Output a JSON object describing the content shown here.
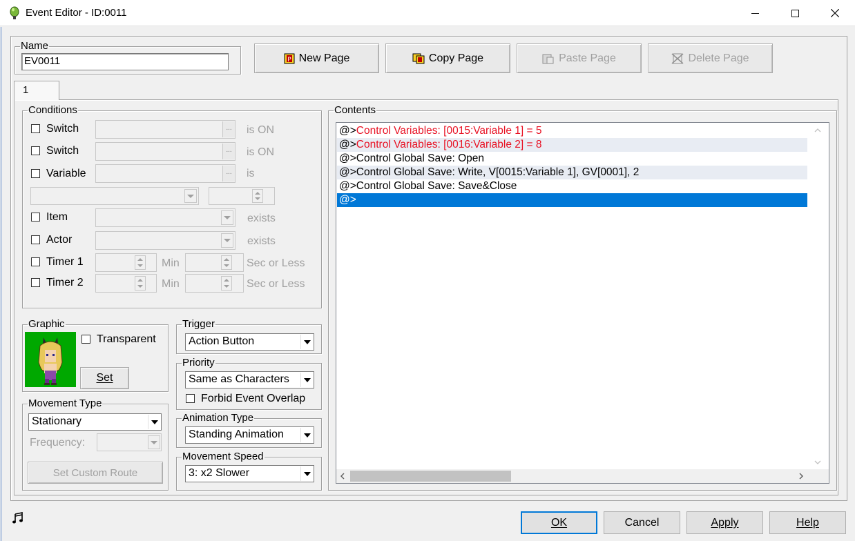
{
  "window": {
    "title": "Event Editor - ID:0011",
    "minimize_icon": "minimize-icon",
    "maximize_icon": "maximize-icon",
    "close_icon": "close-icon"
  },
  "name_group": {
    "legend": "Name",
    "value": "EV0011"
  },
  "page_buttons": {
    "new_page": "New Page",
    "copy_page": "Copy Page",
    "paste_page": "Paste Page",
    "delete_page": "Delete Page"
  },
  "tabs": [
    {
      "label": "1"
    }
  ],
  "conditions": {
    "legend": "Conditions",
    "switch1": {
      "label": "Switch",
      "suffix": "is ON"
    },
    "switch2": {
      "label": "Switch",
      "suffix": "is ON"
    },
    "variable": {
      "label": "Variable",
      "suffix": "is"
    },
    "item": {
      "label": "Item",
      "suffix": "exists"
    },
    "actor": {
      "label": "Actor",
      "suffix": "exists"
    },
    "timer1": {
      "label": "Timer 1",
      "min": "Min",
      "sec": "Sec or Less"
    },
    "timer2": {
      "label": "Timer 2",
      "min": "Min",
      "sec": "Sec or Less"
    },
    "ellipsis": "..."
  },
  "graphic": {
    "legend": "Graphic",
    "transparent_label": "Transparent",
    "set_label": "Set"
  },
  "movement_type": {
    "legend": "Movement Type",
    "value": "Stationary",
    "frequency_label": "Frequency:",
    "custom_route_label": "Set Custom Route"
  },
  "trigger": {
    "legend": "Trigger",
    "value": "Action Button"
  },
  "priority": {
    "legend": "Priority",
    "value": "Same as Characters",
    "forbid_label": "Forbid Event Overlap"
  },
  "animation_type": {
    "legend": "Animation Type",
    "value": "Standing Animation"
  },
  "movement_speed": {
    "legend": "Movement Speed",
    "value": "3: x2 Slower"
  },
  "contents": {
    "legend": "Contents",
    "rows": [
      {
        "prefix": "@>",
        "text": "Control Variables: [0015:Variable 1] = 5",
        "color": "#e81123"
      },
      {
        "prefix": "@>",
        "text": "Control Variables: [0016:Variable 2] = 8",
        "color": "#e81123"
      },
      {
        "prefix": "@>",
        "text": "Control Global Save: Open",
        "color": "#000000"
      },
      {
        "prefix": "@>",
        "text": "Control Global Save: Write, V[0015:Variable 1], GV[0001], 2",
        "color": "#000000"
      },
      {
        "prefix": "@>",
        "text": "Control Global Save: Save&Close",
        "color": "#000000"
      },
      {
        "prefix": "@>",
        "text": "",
        "color": "#ffffff"
      }
    ]
  },
  "footer": {
    "music_icon": "music-note-icon",
    "ok": "OK",
    "cancel": "Cancel",
    "apply": "Apply",
    "help": "Help"
  },
  "colors": {
    "selection": "#0078d7",
    "alt_row": "#e8ecf3",
    "command_red": "#e81123",
    "sprite_bg": "#00a800"
  }
}
